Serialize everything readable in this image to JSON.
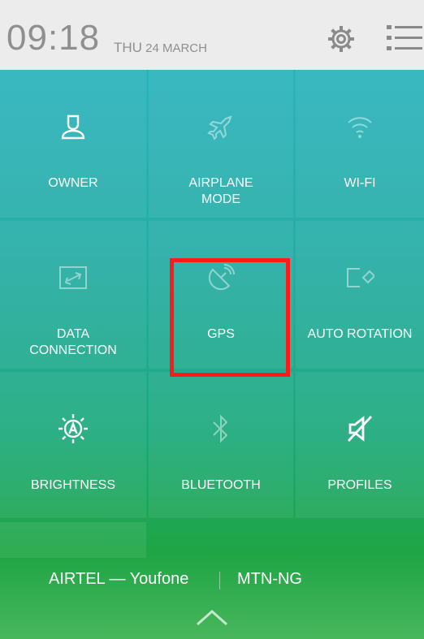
{
  "status": {
    "time": "09:18",
    "day": "THU",
    "date": "24 MARCH"
  },
  "icons": {
    "settings": "gear-icon",
    "list": "list-icon"
  },
  "tiles": [
    {
      "label": "OWNER",
      "icon": "user-icon",
      "state": "on"
    },
    {
      "label": "AIRPLANE\nMODE",
      "icon": "airplane-icon",
      "state": "off"
    },
    {
      "label": "WI-FI",
      "icon": "wifi-icon",
      "state": "off"
    },
    {
      "label": "DATA\nCONNECTION",
      "icon": "data-transfer-icon",
      "state": "off"
    },
    {
      "label": "GPS",
      "icon": "gps-satellite-icon",
      "state": "off"
    },
    {
      "label": "AUTO ROTATION",
      "icon": "rotation-icon",
      "state": "off"
    },
    {
      "label": "BRIGHTNESS",
      "icon": "brightness-auto-icon",
      "state": "on"
    },
    {
      "label": "BLUETOOTH",
      "icon": "bluetooth-icon",
      "state": "off"
    },
    {
      "label": "PROFILES",
      "icon": "sound-off-icon",
      "state": "on"
    }
  ],
  "carriers": {
    "sim1": "AIRTEL — Youfone",
    "sim2": "MTN-NG"
  },
  "colors": {
    "highlight": "#ff1a1a",
    "panel_top": "#2cb3bd",
    "panel_bottom": "#1fa545"
  }
}
